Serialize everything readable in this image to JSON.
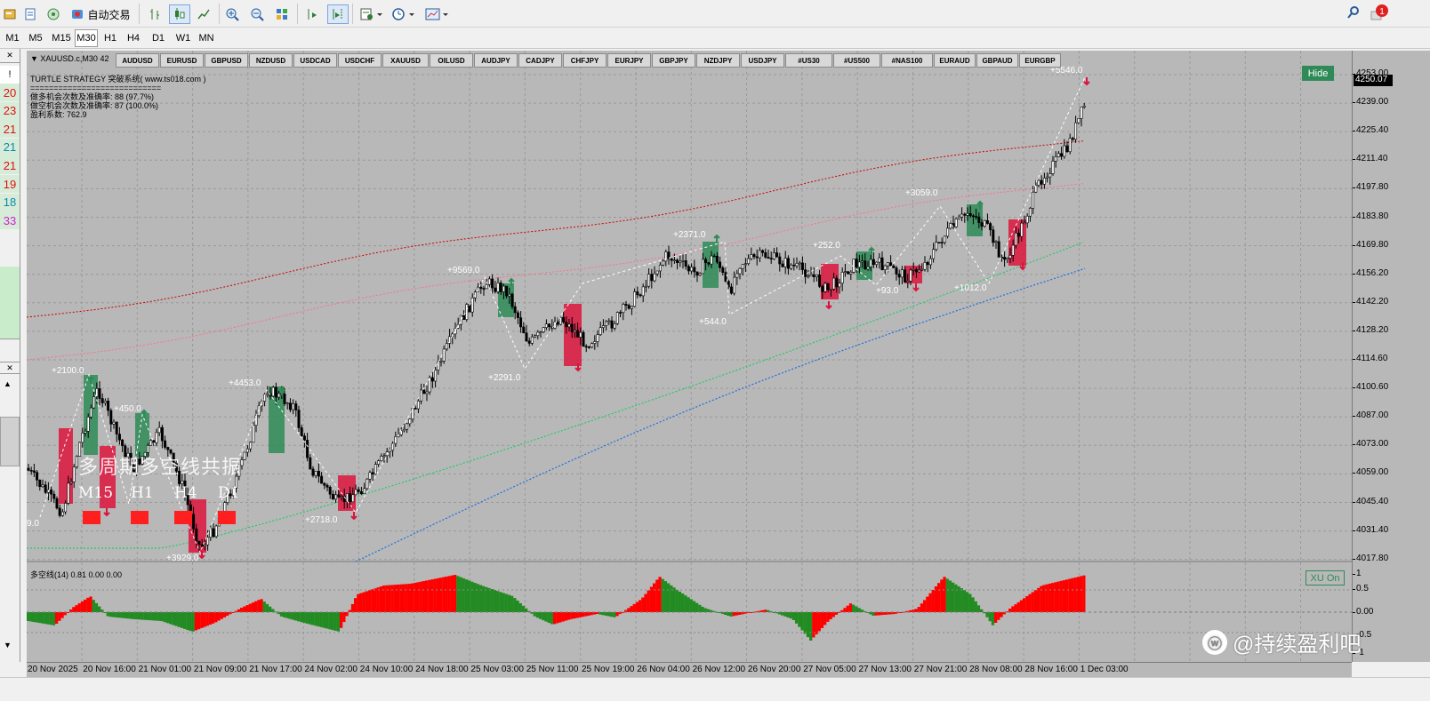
{
  "toolbar": {
    "autotrade_label": "自动交易",
    "icons": [
      "new-order-icon",
      "profiles-icon",
      "market-watch-icon",
      "autotrade-icon",
      "bar-chart-icon",
      "candles-icon",
      "line-chart-icon",
      "zoom-in-icon",
      "zoom-out-icon",
      "tile-icon",
      "autoscroll-icon",
      "chart-shift-icon",
      "indicators-icon",
      "periods-icon",
      "templates-icon",
      "search-icon",
      "notification-icon"
    ],
    "notification_count": "1"
  },
  "timeframes": [
    "M1",
    "M5",
    "M15",
    "M30",
    "H1",
    "H4",
    "D1",
    "W1",
    "MN"
  ],
  "active_timeframe": "M30",
  "side_panel": {
    "marker": "!",
    "numbers": [
      {
        "v": "20",
        "color": "#e01010"
      },
      {
        "v": "23",
        "color": "#e01010"
      },
      {
        "v": "21",
        "color": "#e01010"
      },
      {
        "v": "21",
        "color": "#0a8aa8"
      },
      {
        "v": "21",
        "color": "#e01010"
      },
      {
        "v": "19",
        "color": "#e01010"
      },
      {
        "v": "18",
        "color": "#0a8aa8"
      },
      {
        "v": "33",
        "color": "#d020d0"
      }
    ]
  },
  "chart": {
    "title": "XAUUSD.c,M30  42",
    "symbols": [
      "AUDUSD",
      "EURUSD",
      "GBPUSD",
      "NZDUSD",
      "USDCAD",
      "USDCHF",
      "XAUUSD",
      "OILUSD",
      "AUDJPY",
      "CADJPY",
      "CHFJPY",
      "EURJPY",
      "GBPJPY",
      "NZDJPY",
      "USDJPY",
      "#US30",
      "#US500",
      "#NAS100",
      "EURAUD",
      "GBPAUD",
      "EURGBP"
    ],
    "hide_label": "Hide",
    "info": [
      "TURTLE STRATEGY 突破系统(  www.ts018.com  )",
      "============================",
      "做多机会次数及准确率: 88 (97.7%)",
      "做空机会次数及准确率: 87 (100.0%)",
      "盈利系数: 762.9"
    ],
    "watermark": "多周期多空线共振",
    "tf_labels": [
      "M15",
      "H1",
      "H4",
      "D1"
    ],
    "trade_labels": [
      "+2100.0",
      "+450.0",
      "+4453.0",
      "+9569.0",
      "+2291.0",
      "+2718.0",
      "+3929.0",
      "+2371.0",
      "+544.0",
      "+252.0",
      "+93.0",
      "+3059.0",
      "+1012.0",
      "+5546.0",
      "9.0"
    ],
    "current_price": "4250.07",
    "price_ticks": [
      "4253.00",
      "4239.00",
      "4225.40",
      "4211.40",
      "4197.80",
      "4183.80",
      "4169.80",
      "4156.20",
      "4142.20",
      "4128.20",
      "4114.60",
      "4100.60",
      "4087.00",
      "4073.00",
      "4059.00",
      "4045.40",
      "4031.40",
      "4017.80"
    ],
    "time_ticks": [
      "20 Nov 2025",
      "20 Nov 16:00",
      "21 Nov 01:00",
      "21 Nov 09:00",
      "21 Nov 17:00",
      "24 Nov 02:00",
      "24 Nov 10:00",
      "24 Nov 18:00",
      "25 Nov 03:00",
      "25 Nov 11:00",
      "25 Nov 19:00",
      "26 Nov 04:00",
      "26 Nov 12:00",
      "26 Nov 20:00",
      "27 Nov 05:00",
      "27 Nov 13:00",
      "27 Nov 21:00",
      "28 Nov 08:00",
      "28 Nov 16:00",
      "1 Dec 03:00"
    ]
  },
  "subwindow": {
    "label": "多空线(14) 0.81 0.00 0.00",
    "xu_label": "XU On",
    "ticks": [
      "1",
      "0.5",
      "0.00",
      "-0.5",
      "-1"
    ]
  },
  "overlay": {
    "weibo": "@持续盈利吧"
  },
  "colors": {
    "bull": "#2e8b57",
    "bear": "#dc143c",
    "hist_pos": "#ff0000",
    "hist_neg": "#228b22",
    "ma_green": "#22cc66",
    "ma_blue": "#1e6fe0",
    "band_red": "#cc0000",
    "band_pink": "#ff6f8a"
  }
}
